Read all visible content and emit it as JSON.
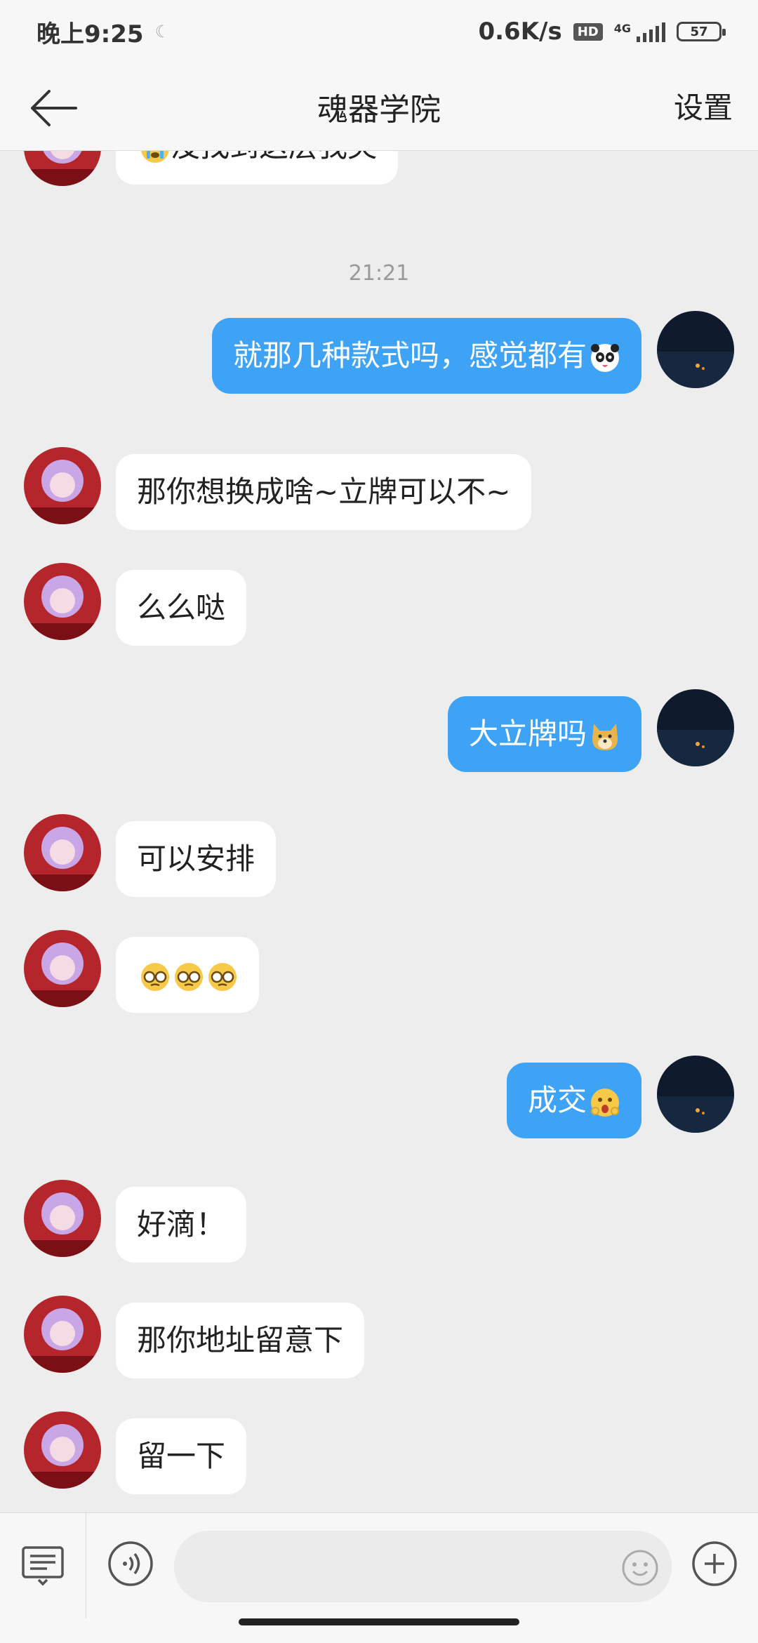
{
  "status_bar": {
    "time": "晚上9:25",
    "network_speed": "0.6K/s",
    "network_type": "4G",
    "hd_label": "HD",
    "battery": "57"
  },
  "header": {
    "back_icon": "arrow-left-icon",
    "title": "魂器学院",
    "settings_label": "设置"
  },
  "messages": [
    {
      "sender": "other",
      "text": "没找到这层我哭",
      "emoji": "crying-face"
    },
    {
      "type": "timestamp",
      "text": "21:21"
    },
    {
      "sender": "me",
      "text": "就那几种款式吗，感觉都有",
      "emoji": "panda-face"
    },
    {
      "sender": "other",
      "text": "那你想换成啥~立牌可以不~"
    },
    {
      "sender": "other",
      "text": "么么哒"
    },
    {
      "sender": "me",
      "text": "大立牌吗",
      "emoji": "doge-face"
    },
    {
      "sender": "other",
      "text": "可以安排"
    },
    {
      "sender": "other",
      "text": "",
      "emoji": "glasses-face x3"
    },
    {
      "sender": "me",
      "text": "成交",
      "emoji": "surprised-face"
    },
    {
      "sender": "other",
      "text": "好滴！"
    },
    {
      "sender": "other",
      "text": "那你地址留意下"
    },
    {
      "sender": "other",
      "text": "留一下"
    }
  ],
  "input_bar": {
    "keyboard_icon": "keyboard-toggle-icon",
    "voice_icon": "voice-icon",
    "emoji_icon": "smile-icon",
    "plus_icon": "plus-icon"
  },
  "colors": {
    "outgoing_bubble": "#3fa3f5",
    "incoming_bubble": "#ffffff",
    "background": "#ededed"
  }
}
